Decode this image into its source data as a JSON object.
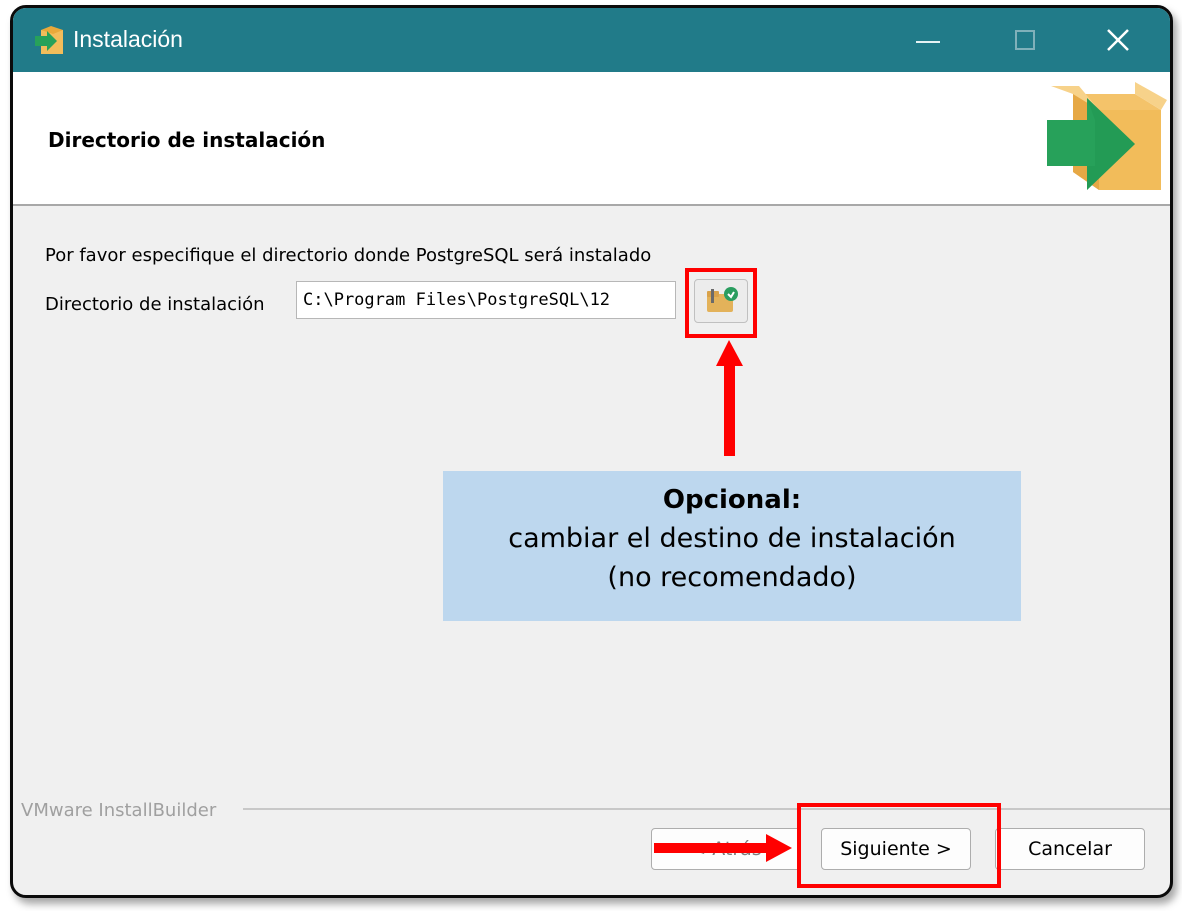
{
  "window": {
    "title": "Instalación",
    "controls": [
      "minimize",
      "maximize",
      "close"
    ]
  },
  "header": {
    "title": "Directorio de instalación",
    "logo_icon": "installer-box-arrow-icon"
  },
  "content": {
    "instruction": "Por favor especifique el directorio donde PostgreSQL será instalado",
    "directory_label": "Directorio de instalación",
    "directory_value": "C:\\Program Files\\PostgreSQL\\12",
    "browse_icon": "folder-browse-icon"
  },
  "annotation": {
    "title": "Opcional:",
    "line1": "cambiar el destino de instalación",
    "line2": "(no recomendado)",
    "color": "#bdd7ee",
    "highlight_color": "#ff0000"
  },
  "footer": {
    "brand": "VMware InstallBuilder",
    "back_label": "< Atrás",
    "next_label": "Siguiente >",
    "cancel_label": "Cancelar"
  },
  "colors": {
    "titlebar": "#217b89",
    "window_bg": "#f0f0f0"
  }
}
